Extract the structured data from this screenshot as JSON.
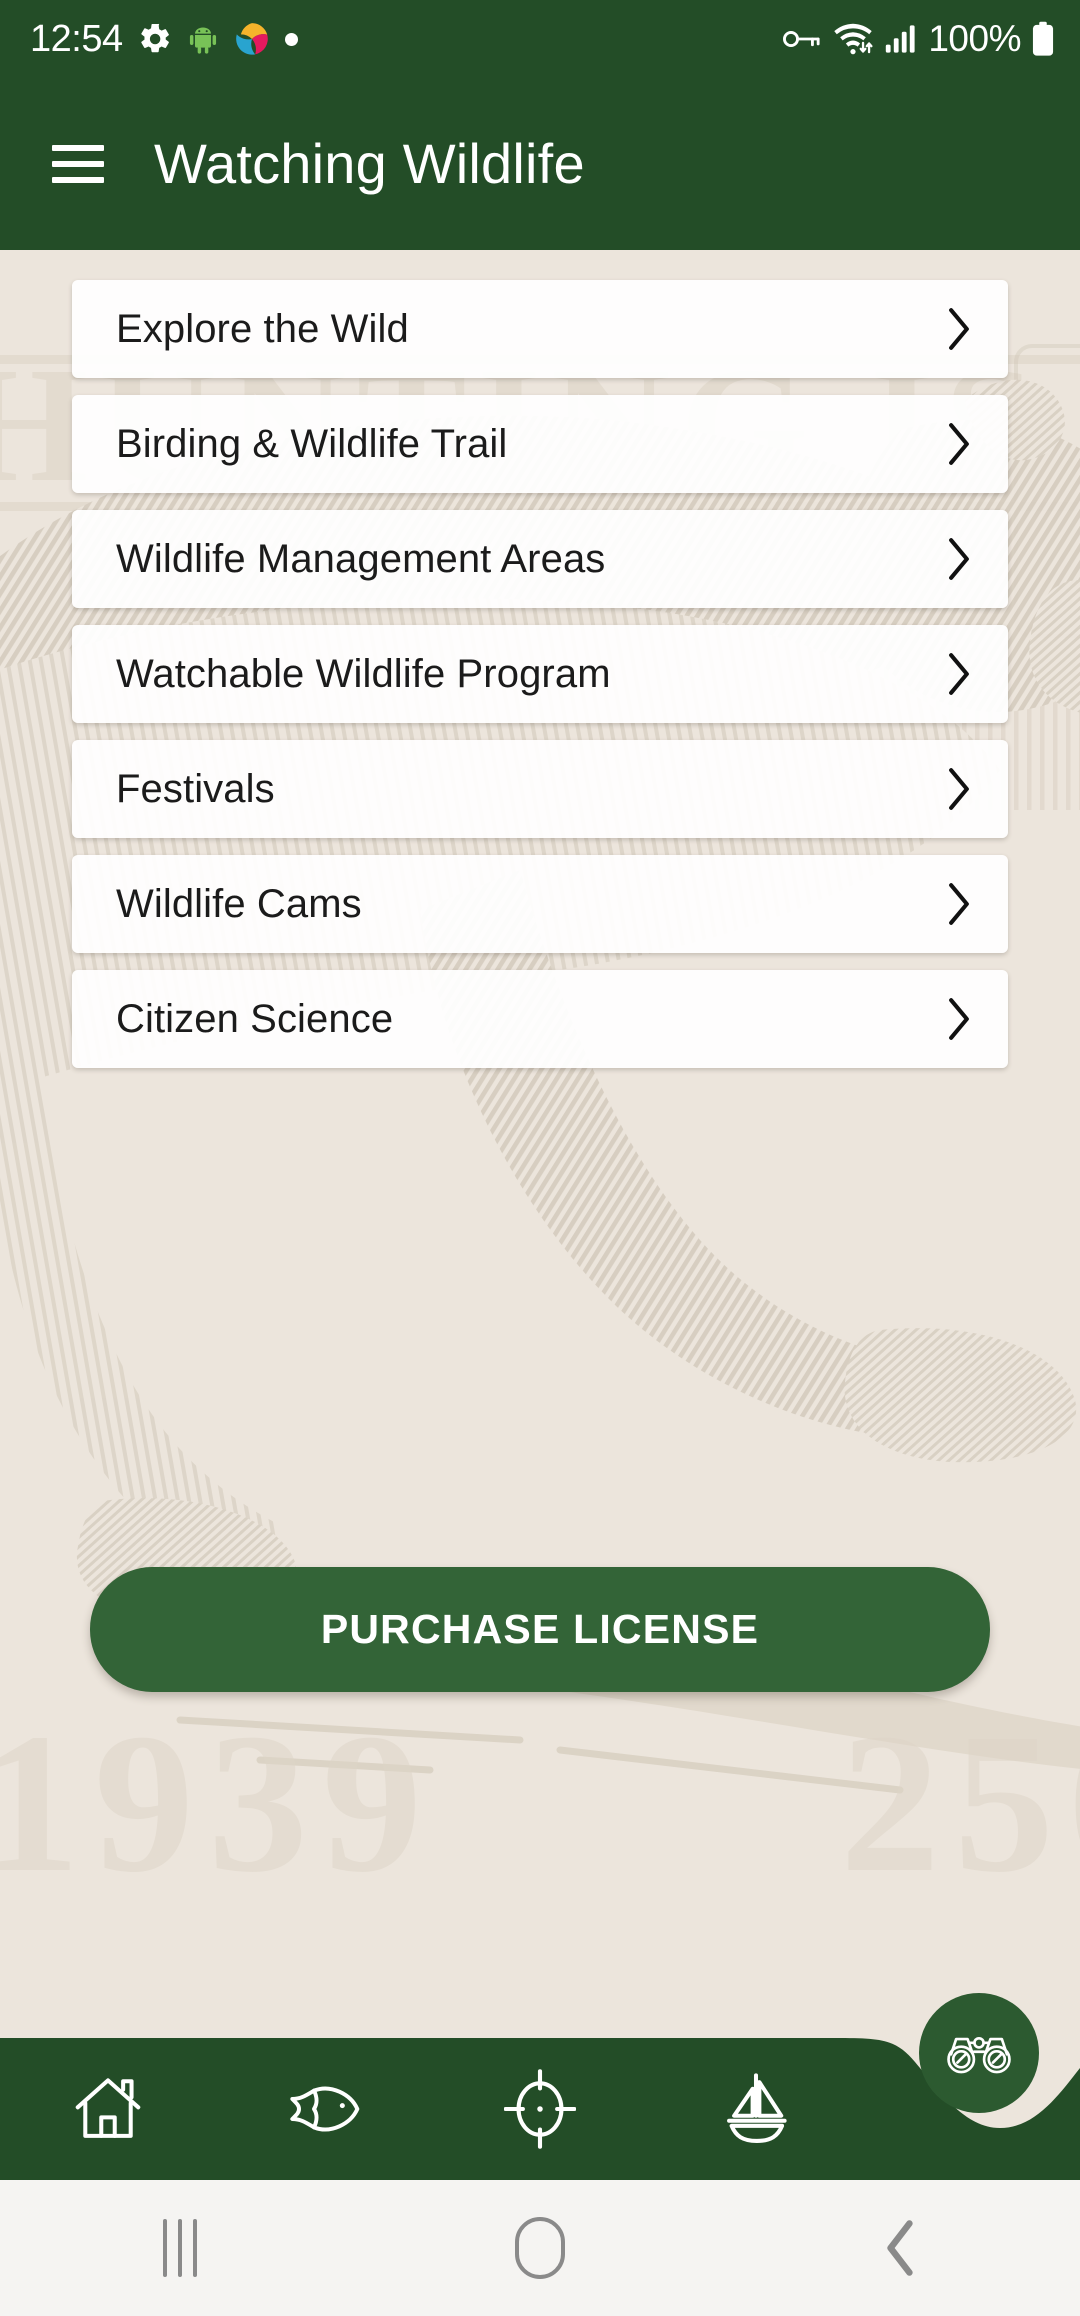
{
  "statusbar": {
    "clock": "12:54",
    "battery_percent": "100%",
    "icons": [
      {
        "name": "settings-gear-icon"
      },
      {
        "name": "android-robot-icon"
      },
      {
        "name": "app-color-swirl-icon"
      },
      {
        "name": "notification-dot-icon"
      },
      {
        "name": "vpn-key-icon"
      },
      {
        "name": "wifi-icon"
      },
      {
        "name": "cellular-signal-icon"
      },
      {
        "name": "battery-icon"
      }
    ]
  },
  "appbar": {
    "menu_icon": "hamburger-menu-icon",
    "title": "Watching Wildlife"
  },
  "main": {
    "items": [
      {
        "label": "Explore the Wild",
        "chevron": "chevron-right-icon"
      },
      {
        "label": "Birding & Wildlife Trail",
        "chevron": "chevron-right-icon"
      },
      {
        "label": "Wildlife Management Areas",
        "chevron": "chevron-right-icon"
      },
      {
        "label": "Watchable Wildlife Program",
        "chevron": "chevron-right-icon"
      },
      {
        "label": "Festivals",
        "chevron": "chevron-right-icon"
      },
      {
        "label": "Wildlife Cams",
        "chevron": "chevron-right-icon"
      },
      {
        "label": "Citizen Science",
        "chevron": "chevron-right-icon"
      }
    ],
    "purchase_button_label": "PURCHASE LICENSE",
    "background_art": "vintage-bear-engraving-watermark"
  },
  "bottomnav": {
    "items": [
      {
        "name": "nav-home",
        "icon": "home-icon"
      },
      {
        "name": "nav-fishing",
        "icon": "fish-icon"
      },
      {
        "name": "nav-hunting",
        "icon": "crosshair-target-icon"
      },
      {
        "name": "nav-boating",
        "icon": "sailboat-icon"
      }
    ],
    "fab": {
      "name": "nav-watching-wildlife-fab",
      "icon": "binoculars-icon"
    }
  },
  "sysnav": {
    "buttons": [
      {
        "name": "recents-button",
        "icon": "recents-icon"
      },
      {
        "name": "home-button",
        "icon": "home-pill-icon"
      },
      {
        "name": "back-button",
        "icon": "back-chevron-icon"
      }
    ]
  },
  "colors": {
    "header_green": "#234d27",
    "accent_green": "#336437",
    "fab_green": "#2c5a30",
    "page_cream": "#ece5dc",
    "card_white": "#fdfcfa",
    "sysnav_gray": "#f5f4f2"
  }
}
